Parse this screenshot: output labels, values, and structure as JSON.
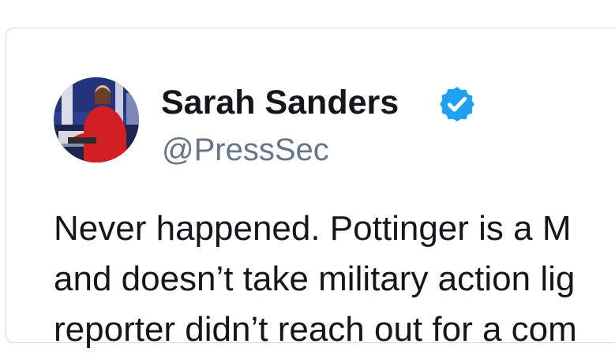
{
  "tweet": {
    "author": {
      "display_name": "Sarah Sanders",
      "handle": "@PressSec",
      "verified": true,
      "verified_icon": "verified-badge-icon",
      "verified_color": "#1da1f2"
    },
    "text_lines": [
      "Never happened. Pottinger is a M",
      "and doesn’t take military action lig",
      "reporter didn’t reach out for a com"
    ]
  },
  "colors": {
    "name": "#14171a",
    "handle": "#657786",
    "border": "#cfd9de",
    "accent": "#1da1f2"
  }
}
